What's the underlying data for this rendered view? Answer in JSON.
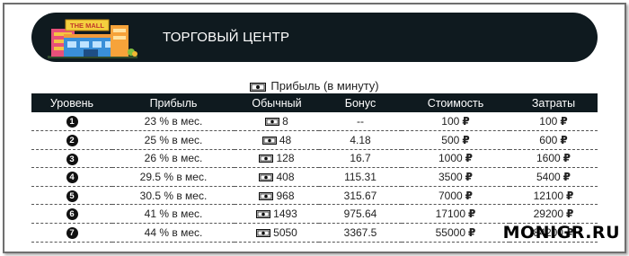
{
  "banner": {
    "sign_text": "THE MALL",
    "title": "ТОРГОВЫЙ ЦЕНТР"
  },
  "caption": "Прибыль (в минуту)",
  "table": {
    "headers": [
      "Уровень",
      "Прибыль",
      "Обычный",
      "Бонус",
      "Стоимость",
      "Затраты"
    ],
    "rows": [
      {
        "level": "1",
        "profit": "23 % в мес.",
        "regular": "8",
        "bonus": "--",
        "cost": "100",
        "expenses": "100"
      },
      {
        "level": "2",
        "profit": "25 % в мес.",
        "regular": "48",
        "bonus": "4.18",
        "cost": "500",
        "expenses": "600"
      },
      {
        "level": "3",
        "profit": "26 % в мес.",
        "regular": "128",
        "bonus": "16.7",
        "cost": "1000",
        "expenses": "1600"
      },
      {
        "level": "4",
        "profit": "29.5 % в мес.",
        "regular": "408",
        "bonus": "115.31",
        "cost": "3500",
        "expenses": "5400"
      },
      {
        "level": "5",
        "profit": "30.5 % в мес.",
        "regular": "968",
        "bonus": "315.67",
        "cost": "7000",
        "expenses": "12100"
      },
      {
        "level": "6",
        "profit": "41 % в мес.",
        "regular": "1493",
        "bonus": "975.64",
        "cost": "17100",
        "expenses": "29200"
      },
      {
        "level": "7",
        "profit": "44 % в мес.",
        "regular": "5050",
        "bonus": "3367.5",
        "cost": "55000",
        "expenses": "84200"
      }
    ],
    "currency_symbol": "₽"
  },
  "watermark": "MONIGR.RU",
  "colors": {
    "banner_bg": "#0f1a1f",
    "header_bg": "#0f1a1f",
    "text": "#222222"
  },
  "icons": {
    "caption": "money-bill-icon",
    "regular": "money-bill-icon",
    "level": "numbered-circle-icon"
  }
}
